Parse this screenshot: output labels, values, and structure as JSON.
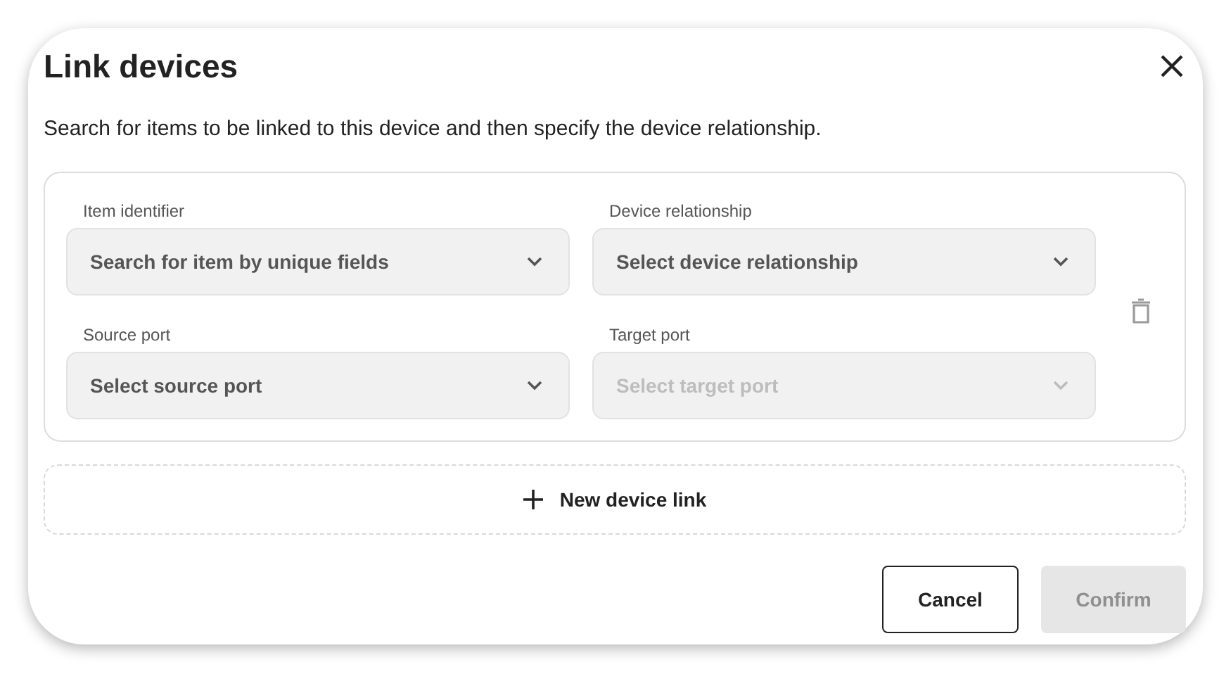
{
  "dialog": {
    "title": "Link devices",
    "description": "Search for items to be linked to this device and then specify the device relationship."
  },
  "link": {
    "fields": [
      {
        "label": "Item identifier",
        "placeholder": "Search for item by unique fields",
        "disabled": false
      },
      {
        "label": "Device relationship",
        "placeholder": "Select device relationship",
        "disabled": false
      },
      {
        "label": "Source port",
        "placeholder": "Select source port",
        "disabled": false
      },
      {
        "label": "Target port",
        "placeholder": "Select target port",
        "disabled": true
      }
    ]
  },
  "add_link": {
    "label": "New device link"
  },
  "buttons": [
    {
      "label": "Cancel",
      "kind": "secondary",
      "disabled": false
    },
    {
      "label": "Confirm",
      "kind": "primary",
      "disabled": true
    }
  ]
}
